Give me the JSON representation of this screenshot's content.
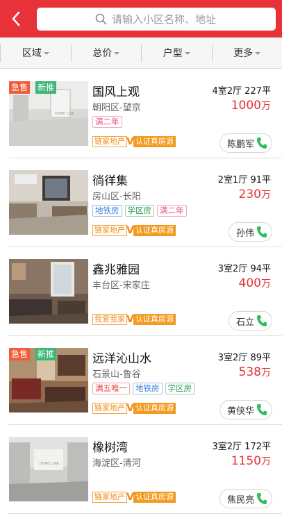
{
  "header": {
    "search_placeholder": "请输入小区名称、地址"
  },
  "filters": [
    {
      "label": "区域"
    },
    {
      "label": "总价"
    },
    {
      "label": "户型"
    },
    {
      "label": "更多"
    }
  ],
  "listings": [
    {
      "title": "国风上观",
      "district": "朝阳区-望京",
      "specs": "4室2厅 227平",
      "price": "1000",
      "price_unit": "万",
      "badges": {
        "hot": "急售",
        "new": "新推"
      },
      "tags": [
        {
          "text": "满二年",
          "color": "pink"
        }
      ],
      "agency": "链家地产",
      "verified": "认证真房源",
      "agent": "陈鹏军"
    },
    {
      "title": "徜徉集",
      "district": "房山区-长阳",
      "specs": "2室1厅 91平",
      "price": "230",
      "price_unit": "万",
      "tags": [
        {
          "text": "地铁房",
          "color": "blue"
        },
        {
          "text": "学区房",
          "color": "green"
        },
        {
          "text": "满二年",
          "color": "pink"
        }
      ],
      "agency": "链家地产",
      "verified": "认证真房源",
      "agent": "孙伟"
    },
    {
      "title": "鑫兆雅园",
      "district": "丰台区-宋家庄",
      "specs": "3室2厅 94平",
      "price": "400",
      "price_unit": "万",
      "tags": [],
      "agency": "我爱我家",
      "verified": "认证真房源",
      "agent": "石立"
    },
    {
      "title": "远洋沁山水",
      "district": "石景山-鲁谷",
      "specs": "3室2厅 89平",
      "price": "538",
      "price_unit": "万",
      "badges": {
        "hot": "急售",
        "new": "新推"
      },
      "tags": [
        {
          "text": "满五唯一",
          "color": "red"
        },
        {
          "text": "地铁房",
          "color": "blue"
        },
        {
          "text": "学区房",
          "color": "green"
        }
      ],
      "agency": "链家地产",
      "verified": "认证真房源",
      "agent": "黄侠华"
    },
    {
      "title": "橡树湾",
      "district": "海淀区-清河",
      "specs": "3室2厅 172平",
      "price": "1150",
      "price_unit": "万",
      "tags": [],
      "agency": "链家地产",
      "verified": "认证真房源",
      "agent": "焦民亮"
    }
  ],
  "colors": {
    "brand_red": "#e8323a",
    "price_red": "#e8323a",
    "agency_orange": "#f39a20",
    "phone_green": "#2ebd5a"
  },
  "icons": {
    "back": "back-arrow-icon",
    "search": "search-icon",
    "phone": "phone-icon",
    "dropdown": "caret-down-icon"
  }
}
